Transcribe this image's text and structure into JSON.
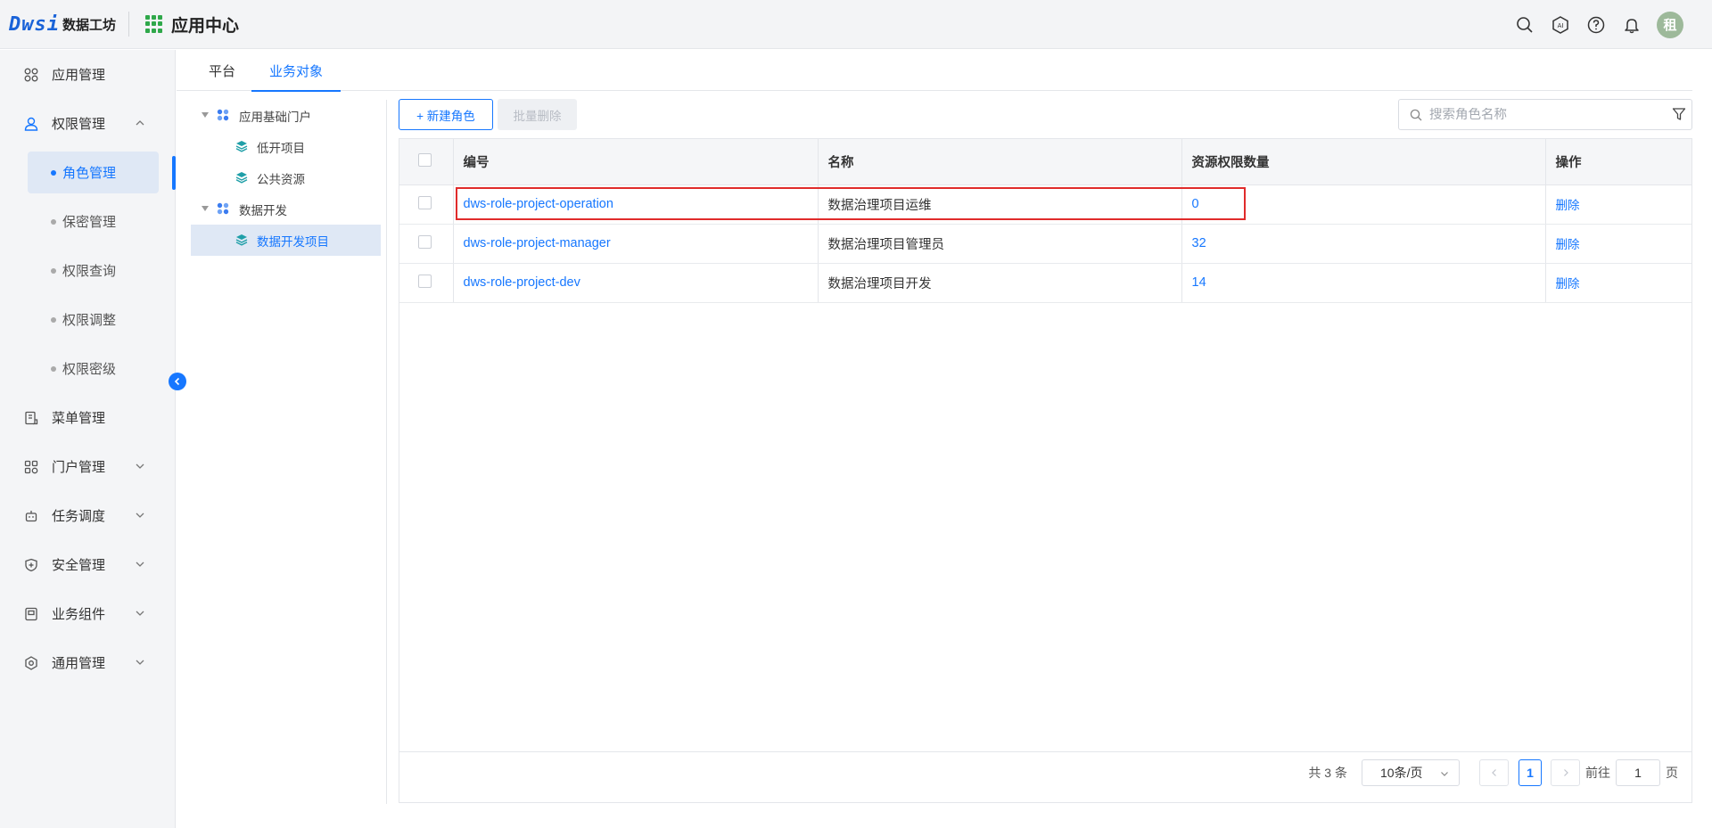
{
  "header": {
    "logo_mark": "Dwsi",
    "logo_text": "数据工坊",
    "app_title": "应用中心",
    "avatar_text": "租"
  },
  "sidebar": {
    "items": [
      {
        "label": "应用管理",
        "icon": "apps-icon"
      },
      {
        "label": "权限管理",
        "icon": "user-icon",
        "expanded": true
      },
      {
        "label": "菜单管理",
        "icon": "menu-doc-icon"
      },
      {
        "label": "门户管理",
        "icon": "portal-icon"
      },
      {
        "label": "任务调度",
        "icon": "robot-icon"
      },
      {
        "label": "安全管理",
        "icon": "shield-icon"
      },
      {
        "label": "业务组件",
        "icon": "component-icon"
      },
      {
        "label": "通用管理",
        "icon": "settings-icon"
      }
    ],
    "sub_items": [
      "角色管理",
      "保密管理",
      "权限查询",
      "权限调整",
      "权限密级"
    ]
  },
  "tabs": [
    "平台",
    "业务对象"
  ],
  "tree": {
    "groups": [
      {
        "label": "应用基础门户",
        "children": [
          "低开项目",
          "公共资源"
        ]
      },
      {
        "label": "数据开发",
        "children": [
          "数据开发项目"
        ]
      }
    ]
  },
  "toolbar": {
    "new_label": "+ 新建角色",
    "batch_label": "批量删除",
    "search_placeholder": "搜索角色名称"
  },
  "table": {
    "headers": [
      "编号",
      "名称",
      "资源权限数量",
      "操作"
    ],
    "rows": [
      {
        "code": "dws-role-project-operation",
        "name": "数据治理项目运维",
        "count": "0",
        "action": "删除"
      },
      {
        "code": "dws-role-project-manager",
        "name": "数据治理项目管理员",
        "count": "32",
        "action": "删除"
      },
      {
        "code": "dws-role-project-dev",
        "name": "数据治理项目开发",
        "count": "14",
        "action": "删除"
      }
    ]
  },
  "pagination": {
    "total": "共 3 条",
    "page_size": "10条/页",
    "current": "1",
    "goto_label": "前往",
    "goto_value": "1",
    "page_suffix": "页"
  },
  "colors": {
    "accent": "#1677ff",
    "highlight": "#e02b2b"
  }
}
